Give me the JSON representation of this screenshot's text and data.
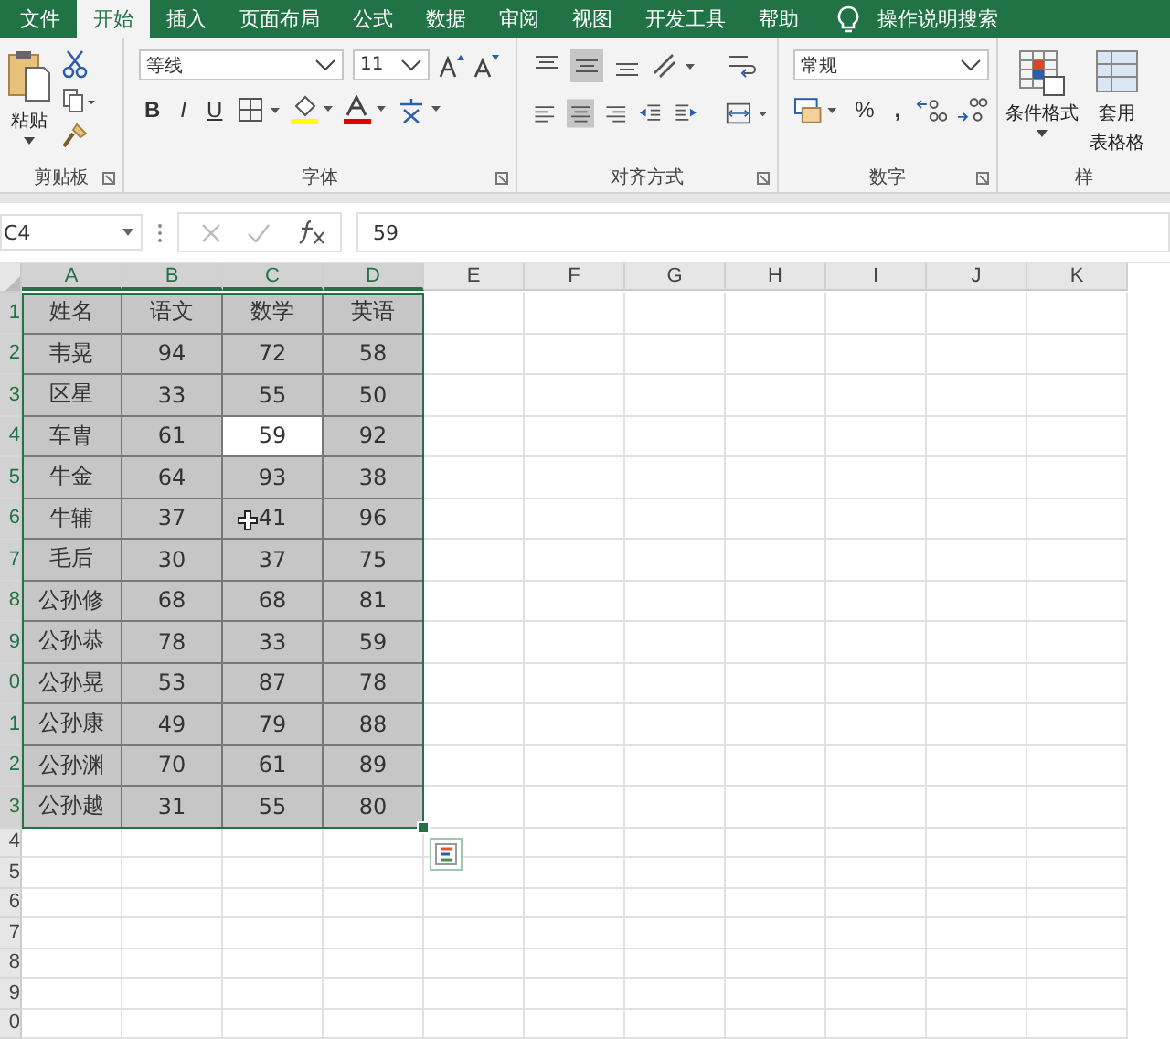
{
  "tabs": [
    {
      "label": "文件",
      "selected": false
    },
    {
      "label": "开始",
      "selected": true
    },
    {
      "label": "插入",
      "selected": false
    },
    {
      "label": "页面布局",
      "selected": false
    },
    {
      "label": "公式",
      "selected": false
    },
    {
      "label": "数据",
      "selected": false
    },
    {
      "label": "审阅",
      "selected": false
    },
    {
      "label": "视图",
      "selected": false
    },
    {
      "label": "开发工具",
      "selected": false
    },
    {
      "label": "帮助",
      "selected": false
    }
  ],
  "search": {
    "placeholder": "操作说明搜索"
  },
  "ribbon": {
    "clipboard": {
      "label": "剪贴板",
      "paste": "粘贴"
    },
    "font": {
      "label": "字体",
      "font_name": "等线",
      "font_size": "11",
      "bold": "B",
      "italic": "I",
      "underline": "U"
    },
    "alignment": {
      "label": "对齐方式"
    },
    "number": {
      "label": "数字",
      "format": "常规",
      "percent": "%",
      "comma": ","
    },
    "styles": {
      "label": "样",
      "conditional_format": "条件格式",
      "table_format_1": "套用",
      "table_format_2": "表格格"
    }
  },
  "formula_bar": {
    "name_box": "C4",
    "value": "59"
  },
  "sheet": {
    "columns": [
      "A",
      "B",
      "C",
      "D",
      "E",
      "F",
      "G",
      "H",
      "I",
      "J",
      "K"
    ],
    "rows": [
      {
        "header": "1",
        "in_selection": true,
        "cells": [
          {
            "text": "姓名",
            "active": false
          },
          {
            "text": "语文",
            "active": false
          },
          {
            "text": "数学",
            "active": false
          },
          {
            "text": "英语",
            "active": false
          }
        ]
      },
      {
        "header": "2",
        "in_selection": true,
        "cells": [
          {
            "text": "韦晃",
            "active": false
          },
          {
            "text": "94",
            "active": false
          },
          {
            "text": "72",
            "active": false
          },
          {
            "text": "58",
            "active": false
          }
        ]
      },
      {
        "header": "3",
        "in_selection": true,
        "cells": [
          {
            "text": "区星",
            "active": false
          },
          {
            "text": "33",
            "active": false
          },
          {
            "text": "55",
            "active": false
          },
          {
            "text": "50",
            "active": false
          }
        ]
      },
      {
        "header": "4",
        "in_selection": true,
        "cells": [
          {
            "text": "车胄",
            "active": false
          },
          {
            "text": "61",
            "active": false
          },
          {
            "text": "59",
            "active": true
          },
          {
            "text": "92",
            "active": false
          }
        ]
      },
      {
        "header": "5",
        "in_selection": true,
        "cells": [
          {
            "text": "牛金",
            "active": false
          },
          {
            "text": "64",
            "active": false
          },
          {
            "text": "93",
            "active": false
          },
          {
            "text": "38",
            "active": false
          }
        ]
      },
      {
        "header": "6",
        "in_selection": true,
        "cells": [
          {
            "text": "牛辅",
            "active": false
          },
          {
            "text": "37",
            "active": false
          },
          {
            "text": "41",
            "active": false
          },
          {
            "text": "96",
            "active": false
          }
        ]
      },
      {
        "header": "7",
        "in_selection": true,
        "cells": [
          {
            "text": "毛后",
            "active": false
          },
          {
            "text": "30",
            "active": false
          },
          {
            "text": "37",
            "active": false
          },
          {
            "text": "75",
            "active": false
          }
        ]
      },
      {
        "header": "8",
        "in_selection": true,
        "cells": [
          {
            "text": "公孙修",
            "active": false
          },
          {
            "text": "68",
            "active": false
          },
          {
            "text": "68",
            "active": false
          },
          {
            "text": "81",
            "active": false
          }
        ]
      },
      {
        "header": "9",
        "in_selection": true,
        "cells": [
          {
            "text": "公孙恭",
            "active": false
          },
          {
            "text": "78",
            "active": false
          },
          {
            "text": "33",
            "active": false
          },
          {
            "text": "59",
            "active": false
          }
        ]
      },
      {
        "header": "0",
        "in_selection": true,
        "cells": [
          {
            "text": "公孙晃",
            "active": false
          },
          {
            "text": "53",
            "active": false
          },
          {
            "text": "87",
            "active": false
          },
          {
            "text": "78",
            "active": false
          }
        ]
      },
      {
        "header": "1",
        "in_selection": true,
        "cells": [
          {
            "text": "公孙康",
            "active": false
          },
          {
            "text": "49",
            "active": false
          },
          {
            "text": "79",
            "active": false
          },
          {
            "text": "88",
            "active": false
          }
        ]
      },
      {
        "header": "2",
        "in_selection": true,
        "cells": [
          {
            "text": "公孙渊",
            "active": false
          },
          {
            "text": "70",
            "active": false
          },
          {
            "text": "61",
            "active": false
          },
          {
            "text": "89",
            "active": false
          }
        ]
      },
      {
        "header": "3",
        "in_selection": true,
        "cells": [
          {
            "text": "公孙越",
            "active": false
          },
          {
            "text": "31",
            "active": false
          },
          {
            "text": "55",
            "active": false
          },
          {
            "text": "80",
            "active": false
          }
        ]
      },
      {
        "header": "4",
        "in_selection": false,
        "cells": []
      },
      {
        "header": "5",
        "in_selection": false,
        "cells": []
      },
      {
        "header": "6",
        "in_selection": false,
        "cells": []
      },
      {
        "header": "7",
        "in_selection": false,
        "cells": []
      },
      {
        "header": "8",
        "in_selection": false,
        "cells": []
      },
      {
        "header": "9",
        "in_selection": false,
        "cells": []
      },
      {
        "header": "0",
        "in_selection": false,
        "cells": []
      }
    ]
  }
}
